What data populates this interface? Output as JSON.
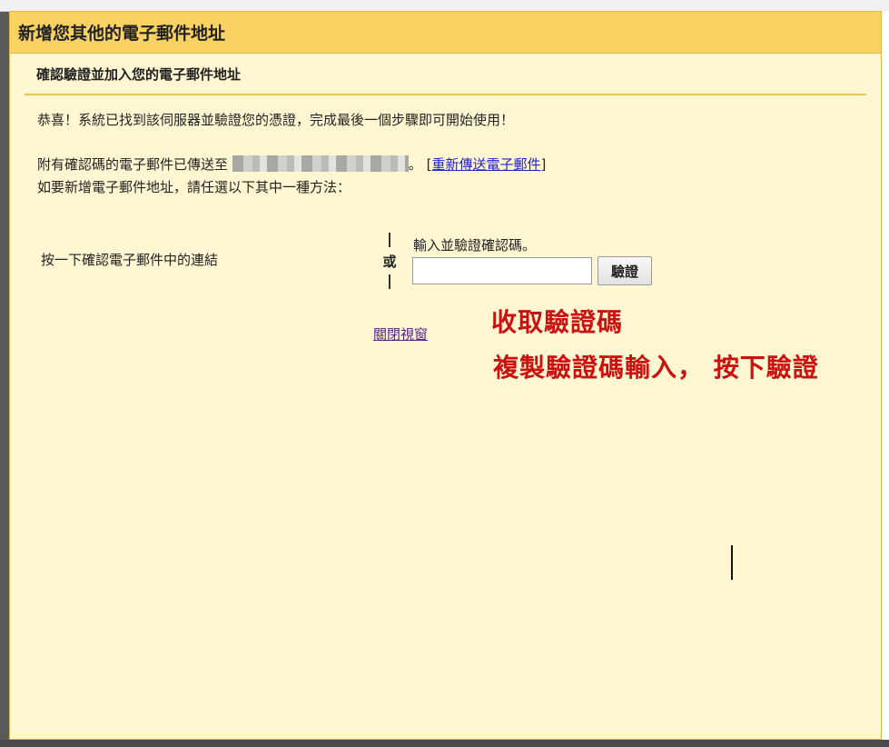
{
  "dialog": {
    "title": "新增您其他的電子郵件地址",
    "subtitle": "確認驗證並加入您的電子郵件地址"
  },
  "body": {
    "congrats": "恭喜！系統已找到該伺服器並驗證您的憑證，完成最後一個步驟即可開始使用！",
    "sent_prefix": "附有確認碼的電子郵件已傳送至",
    "sent_suffix": "。",
    "resend_open": "[",
    "resend_label": "重新傳送電子郵件",
    "resend_close": "]",
    "choose_method": "如要新增電子郵件地址，請任選以下其中一種方法："
  },
  "methods": {
    "click_link": "按一下確認電子郵件中的連結",
    "or": "或",
    "code_label": "輸入並驗證確認碼。",
    "code_value": "",
    "verify_button": "驗證"
  },
  "close_window": "關閉視窗",
  "annotations": {
    "line1": "收取驗證碼",
    "line2": "複製驗證碼輸入， 按下驗證"
  },
  "colors": {
    "titlebar": "#fad163",
    "dialog_bg": "#fff7d2",
    "annotation": "#cc1111"
  }
}
